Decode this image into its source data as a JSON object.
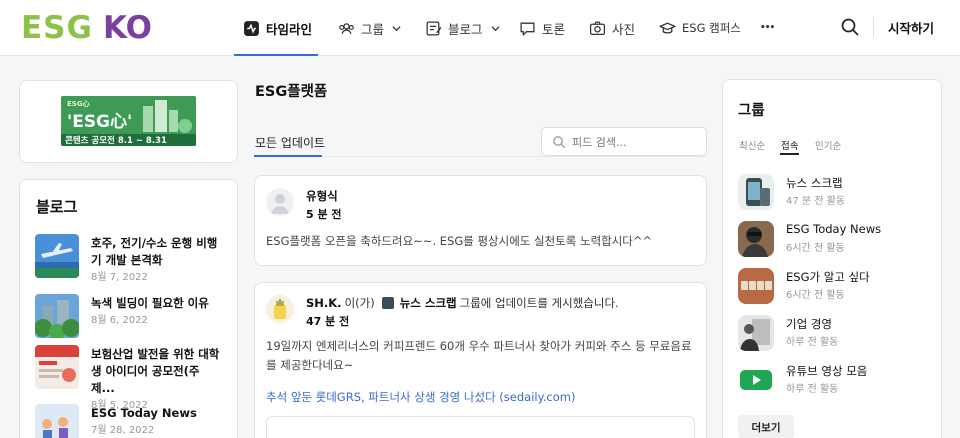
{
  "header": {
    "logo_text": "ESGKO",
    "nav": [
      {
        "label": "타임라인",
        "icon": "timeline-icon",
        "active": true
      },
      {
        "label": "그룹",
        "icon": "group-icon",
        "dropdown": true
      },
      {
        "label": "블로그",
        "icon": "blog-icon",
        "dropdown": true
      },
      {
        "label": "토론",
        "icon": "discussion-icon"
      },
      {
        "label": "사진",
        "icon": "camera-icon"
      },
      {
        "label": "ESG 캠퍼스",
        "icon": "campus-icon"
      }
    ],
    "more_label": "•••",
    "start_label": "시작하기"
  },
  "left": {
    "banner": {
      "logo_text": "ESG心",
      "headline": "'ESG心'",
      "subline": "콘텐츠 공모전 8.1 ~ 8.31"
    },
    "blog_title": "블로그",
    "blog_items": [
      {
        "title": "호주, 전기/수소 운행 비행기 개발 본격화",
        "date": "8월 7, 2022"
      },
      {
        "title": "녹색 빌딩이 필요한 이유",
        "date": "8월 6, 2022"
      },
      {
        "title": "보험산업 발전을 위한 대학생 아이디어 공모전(주제...",
        "date": "8월 5, 2022"
      },
      {
        "title": "ESG Today News",
        "date": "7월 28, 2022"
      }
    ]
  },
  "center": {
    "page_title": "ESG플랫폼",
    "tab_label": "모든 업데이트",
    "search_placeholder": "피드 검색...",
    "posts": [
      {
        "author": "유형식",
        "time": "5 분 전",
        "body": "ESG플랫폼 오픈을 축하드려요~~. ESG를 평상시에도 실천토록 노력합시다^^"
      },
      {
        "author": "SH.K.",
        "author_suffix": "이(가)",
        "group": "뉴스 스크랩",
        "action": "그룹에 업데이트를 게시했습니다.",
        "time": "47 분 전",
        "body": "19일까지 엔제리너스의 커피프렌드 60개 우수 파트너사 찾아가 커피와 주스 등 무료음료를 제공한다네요~",
        "link": "추석 앞둔 롯데GRS, 파트너사 상생 경영 나섰다 (sedaily.com)"
      }
    ]
  },
  "right": {
    "title": "그룹",
    "sort_tabs": [
      "최신순",
      "접속",
      "인기순"
    ],
    "active_sort": "접속",
    "groups": [
      {
        "name": "뉴스 스크랩",
        "activity": "47 분 전 활동"
      },
      {
        "name": "ESG Today News",
        "activity": "6시간 전 활동"
      },
      {
        "name": "ESG가 알고 싶다",
        "activity": "6시간 전 활동"
      },
      {
        "name": "기업 경영",
        "activity": "하루 전 활동"
      },
      {
        "name": "유튜브 영상 모음",
        "activity": "하루 전 활동"
      }
    ],
    "more_label": "더보기"
  },
  "colors": {
    "accent": "#3a6bd1",
    "logo_green": "#8bc34a",
    "logo_purple": "#7b3fa0"
  }
}
